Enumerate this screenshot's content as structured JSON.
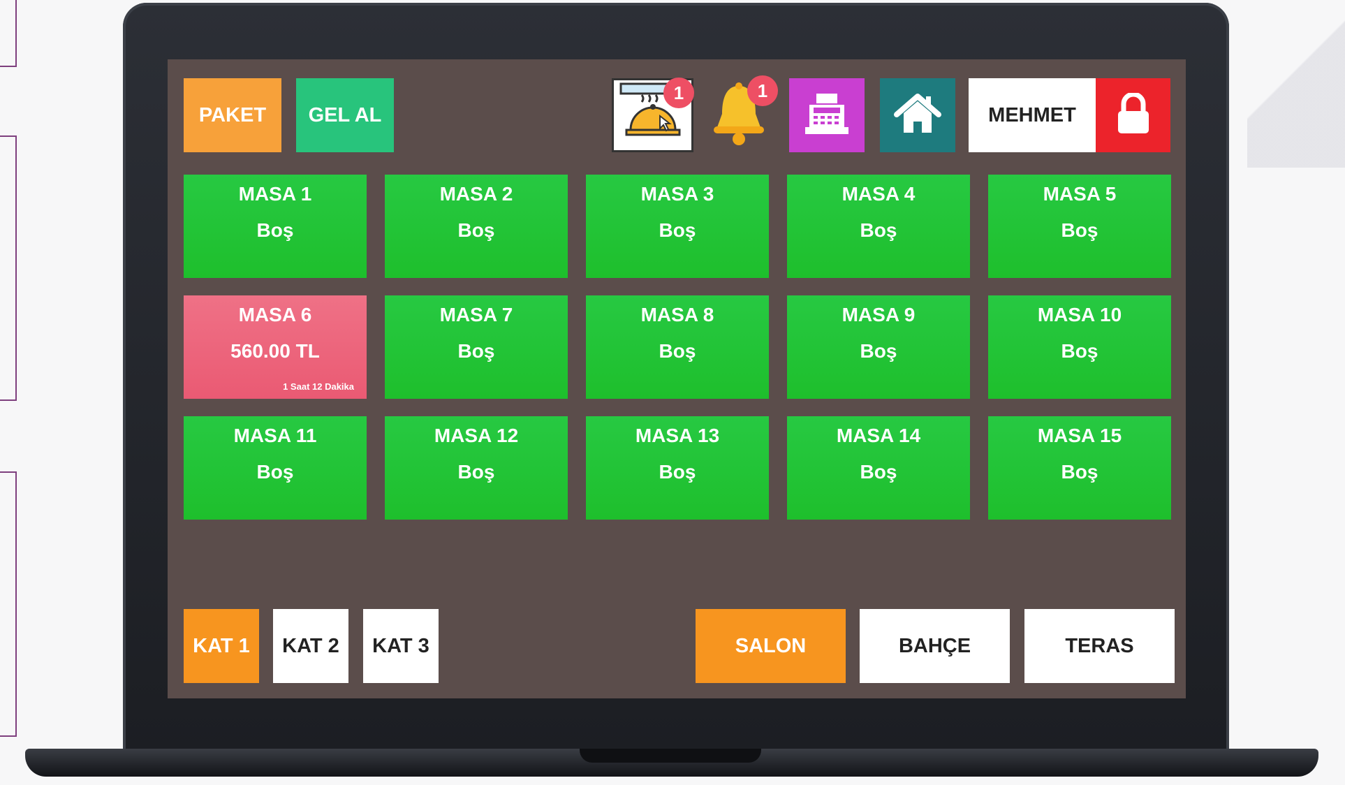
{
  "header": {
    "paket_label": "PAKET",
    "gel_al_label": "GEL AL",
    "orders_badge": "1",
    "notifications_badge": "1",
    "user_name": "MEHMET"
  },
  "tables": [
    {
      "name": "MASA 1",
      "status": "Boş",
      "time": "",
      "color": "#27c942"
    },
    {
      "name": "MASA 2",
      "status": "Boş",
      "time": "",
      "color": "#27c942"
    },
    {
      "name": "MASA 3",
      "status": "Boş",
      "time": "",
      "color": "#27c942"
    },
    {
      "name": "MASA 4",
      "status": "Boş",
      "time": "",
      "color": "#27c942"
    },
    {
      "name": "MASA 5",
      "status": "Boş",
      "time": "",
      "color": "#27c942"
    },
    {
      "name": "MASA 6",
      "status": "560.00 TL",
      "time": "1 Saat 12 Dakika",
      "color": "#ea5a73"
    },
    {
      "name": "MASA 7",
      "status": "Boş",
      "time": "",
      "color": "#27c942"
    },
    {
      "name": "MASA 8",
      "status": "Boş",
      "time": "",
      "color": "#27c942"
    },
    {
      "name": "MASA 9",
      "status": "Boş",
      "time": "",
      "color": "#27c942"
    },
    {
      "name": "MASA 10",
      "status": "Boş",
      "time": "",
      "color": "#27c942"
    },
    {
      "name": "MASA 11",
      "status": "Boş",
      "time": "",
      "color": "#27c942"
    },
    {
      "name": "MASA 12",
      "status": "Boş",
      "time": "",
      "color": "#27c942"
    },
    {
      "name": "MASA 13",
      "status": "Boş",
      "time": "",
      "color": "#27c942"
    },
    {
      "name": "MASA 14",
      "status": "Boş",
      "time": "",
      "color": "#27c942"
    },
    {
      "name": "MASA 15",
      "status": "Boş",
      "time": "",
      "color": "#27c942"
    }
  ],
  "floors": [
    {
      "label": "KAT 1",
      "active": true
    },
    {
      "label": "KAT 2",
      "active": false
    },
    {
      "label": "KAT 3",
      "active": false
    }
  ],
  "areas": [
    {
      "label": "SALON",
      "active": true
    },
    {
      "label": "BAHÇE",
      "active": false
    },
    {
      "label": "TERAS",
      "active": false
    }
  ],
  "icons": {
    "orders": "cloche-order-icon",
    "notifications": "bell-icon",
    "register": "cash-register-icon",
    "home": "home-icon",
    "lock": "lock-icon"
  },
  "colors": {
    "accent_orange": "#f7951f",
    "table_free": "#27c942",
    "table_busy": "#ea5a73",
    "lock_red": "#ec232b"
  }
}
